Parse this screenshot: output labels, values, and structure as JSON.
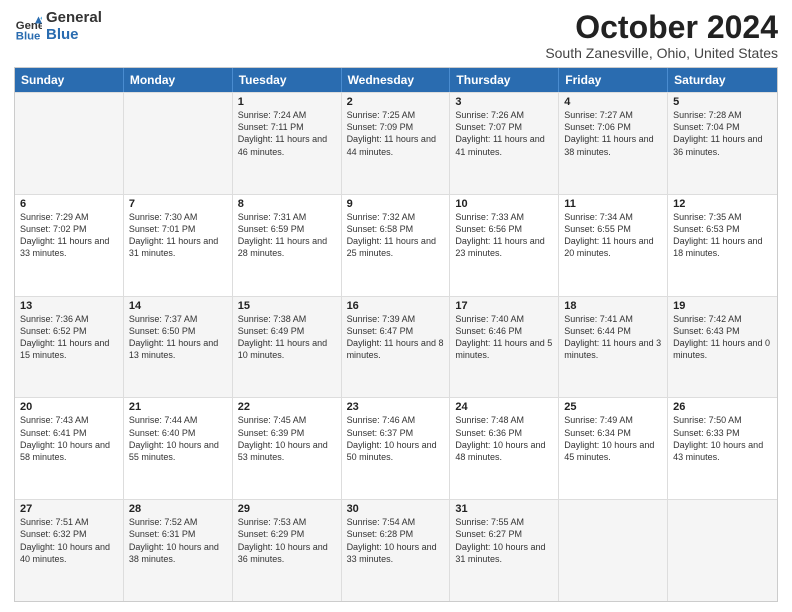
{
  "logo": {
    "general": "General",
    "blue": "Blue"
  },
  "title": "October 2024",
  "subtitle": "South Zanesville, Ohio, United States",
  "headers": [
    "Sunday",
    "Monday",
    "Tuesday",
    "Wednesday",
    "Thursday",
    "Friday",
    "Saturday"
  ],
  "weeks": [
    [
      {
        "day": "",
        "text": ""
      },
      {
        "day": "",
        "text": ""
      },
      {
        "day": "1",
        "text": "Sunrise: 7:24 AM\nSunset: 7:11 PM\nDaylight: 11 hours and 46 minutes."
      },
      {
        "day": "2",
        "text": "Sunrise: 7:25 AM\nSunset: 7:09 PM\nDaylight: 11 hours and 44 minutes."
      },
      {
        "day": "3",
        "text": "Sunrise: 7:26 AM\nSunset: 7:07 PM\nDaylight: 11 hours and 41 minutes."
      },
      {
        "day": "4",
        "text": "Sunrise: 7:27 AM\nSunset: 7:06 PM\nDaylight: 11 hours and 38 minutes."
      },
      {
        "day": "5",
        "text": "Sunrise: 7:28 AM\nSunset: 7:04 PM\nDaylight: 11 hours and 36 minutes."
      }
    ],
    [
      {
        "day": "6",
        "text": "Sunrise: 7:29 AM\nSunset: 7:02 PM\nDaylight: 11 hours and 33 minutes."
      },
      {
        "day": "7",
        "text": "Sunrise: 7:30 AM\nSunset: 7:01 PM\nDaylight: 11 hours and 31 minutes."
      },
      {
        "day": "8",
        "text": "Sunrise: 7:31 AM\nSunset: 6:59 PM\nDaylight: 11 hours and 28 minutes."
      },
      {
        "day": "9",
        "text": "Sunrise: 7:32 AM\nSunset: 6:58 PM\nDaylight: 11 hours and 25 minutes."
      },
      {
        "day": "10",
        "text": "Sunrise: 7:33 AM\nSunset: 6:56 PM\nDaylight: 11 hours and 23 minutes."
      },
      {
        "day": "11",
        "text": "Sunrise: 7:34 AM\nSunset: 6:55 PM\nDaylight: 11 hours and 20 minutes."
      },
      {
        "day": "12",
        "text": "Sunrise: 7:35 AM\nSunset: 6:53 PM\nDaylight: 11 hours and 18 minutes."
      }
    ],
    [
      {
        "day": "13",
        "text": "Sunrise: 7:36 AM\nSunset: 6:52 PM\nDaylight: 11 hours and 15 minutes."
      },
      {
        "day": "14",
        "text": "Sunrise: 7:37 AM\nSunset: 6:50 PM\nDaylight: 11 hours and 13 minutes."
      },
      {
        "day": "15",
        "text": "Sunrise: 7:38 AM\nSunset: 6:49 PM\nDaylight: 11 hours and 10 minutes."
      },
      {
        "day": "16",
        "text": "Sunrise: 7:39 AM\nSunset: 6:47 PM\nDaylight: 11 hours and 8 minutes."
      },
      {
        "day": "17",
        "text": "Sunrise: 7:40 AM\nSunset: 6:46 PM\nDaylight: 11 hours and 5 minutes."
      },
      {
        "day": "18",
        "text": "Sunrise: 7:41 AM\nSunset: 6:44 PM\nDaylight: 11 hours and 3 minutes."
      },
      {
        "day": "19",
        "text": "Sunrise: 7:42 AM\nSunset: 6:43 PM\nDaylight: 11 hours and 0 minutes."
      }
    ],
    [
      {
        "day": "20",
        "text": "Sunrise: 7:43 AM\nSunset: 6:41 PM\nDaylight: 10 hours and 58 minutes."
      },
      {
        "day": "21",
        "text": "Sunrise: 7:44 AM\nSunset: 6:40 PM\nDaylight: 10 hours and 55 minutes."
      },
      {
        "day": "22",
        "text": "Sunrise: 7:45 AM\nSunset: 6:39 PM\nDaylight: 10 hours and 53 minutes."
      },
      {
        "day": "23",
        "text": "Sunrise: 7:46 AM\nSunset: 6:37 PM\nDaylight: 10 hours and 50 minutes."
      },
      {
        "day": "24",
        "text": "Sunrise: 7:48 AM\nSunset: 6:36 PM\nDaylight: 10 hours and 48 minutes."
      },
      {
        "day": "25",
        "text": "Sunrise: 7:49 AM\nSunset: 6:34 PM\nDaylight: 10 hours and 45 minutes."
      },
      {
        "day": "26",
        "text": "Sunrise: 7:50 AM\nSunset: 6:33 PM\nDaylight: 10 hours and 43 minutes."
      }
    ],
    [
      {
        "day": "27",
        "text": "Sunrise: 7:51 AM\nSunset: 6:32 PM\nDaylight: 10 hours and 40 minutes."
      },
      {
        "day": "28",
        "text": "Sunrise: 7:52 AM\nSunset: 6:31 PM\nDaylight: 10 hours and 38 minutes."
      },
      {
        "day": "29",
        "text": "Sunrise: 7:53 AM\nSunset: 6:29 PM\nDaylight: 10 hours and 36 minutes."
      },
      {
        "day": "30",
        "text": "Sunrise: 7:54 AM\nSunset: 6:28 PM\nDaylight: 10 hours and 33 minutes."
      },
      {
        "day": "31",
        "text": "Sunrise: 7:55 AM\nSunset: 6:27 PM\nDaylight: 10 hours and 31 minutes."
      },
      {
        "day": "",
        "text": ""
      },
      {
        "day": "",
        "text": ""
      }
    ]
  ],
  "alt_rows": [
    0,
    2,
    4
  ]
}
